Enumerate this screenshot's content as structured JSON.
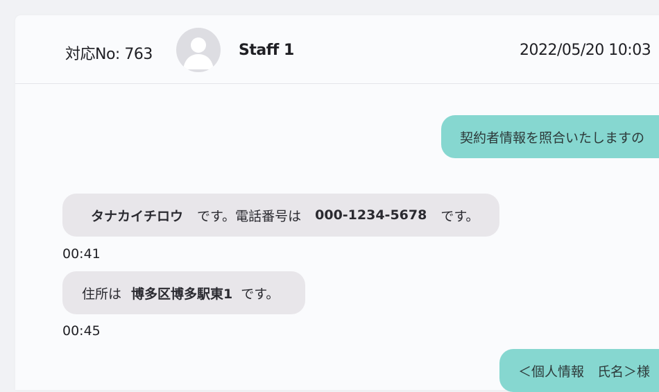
{
  "header": {
    "ticket_label": "対応No: 763",
    "staff_name": "Staff 1",
    "datetime": "2022/05/20 10:03",
    "avatar_icon": "user-avatar-icon"
  },
  "messages": [
    {
      "side": "out",
      "text": "契約者情報を照合いたしますの"
    },
    {
      "side": "in",
      "parts": {
        "name": "タナカイチロウ",
        "desu1": "です。電話番号は",
        "phone": "000-1234-5678",
        "desu2": "です。"
      },
      "time": "00:41"
    },
    {
      "side": "in",
      "parts": {
        "prefix": "住所は",
        "address": "博多区博多駅東1",
        "desu": "です。"
      },
      "time": "00:45"
    },
    {
      "side": "out",
      "text": "＜個人情報　氏名＞様"
    }
  ],
  "colors": {
    "outgoing_bubble": "#86d7d0",
    "incoming_bubble": "#e8e6ea",
    "background": "#fafbfd"
  }
}
